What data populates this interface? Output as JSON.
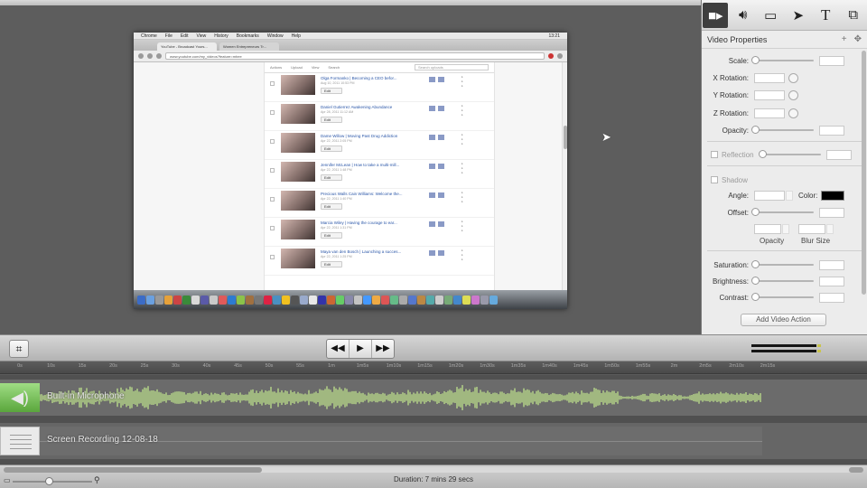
{
  "recording": {
    "menubar": [
      "Chrome",
      "File",
      "Edit",
      "View",
      "History",
      "Bookmarks",
      "Window",
      "Help"
    ],
    "clock": "13:21",
    "tabs": [
      "YouTube - Broadcast Yours...",
      "Women Entrepreneurs Tr..."
    ],
    "url": "www.youtube.com/my_videos?feature=mhee",
    "toolbar": [
      "Actions",
      "Upload",
      "View",
      "Search"
    ],
    "search_placeholder": "Search uploads",
    "videos": [
      {
        "title": "Olga Formanko | Becoming a CEO befor...",
        "date": "Aug 10, 2011 10:53 PM",
        "edit": "Edit"
      },
      {
        "title": "Daniel Gutierrez Awakening Abundance",
        "date": "Apr 28, 2011 11:12 AM",
        "edit": "Edit"
      },
      {
        "title": "Dame Willow | Moving Past Drug Addiction",
        "date": "Apr 22, 2011 2:05 PM",
        "edit": "Edit"
      },
      {
        "title": "Jennifer McLean | How to take a multi-mill...",
        "date": "Apr 22, 2011 1:48 PM",
        "edit": "Edit"
      },
      {
        "title": "Precious Walls Cain Williams: Welcome the...",
        "date": "Apr 22, 2011 1:40 PM",
        "edit": "Edit"
      },
      {
        "title": "Marcia Wiley | Having the courage to ear...",
        "date": "Apr 22, 2011 1:31 PM",
        "edit": "Edit"
      },
      {
        "title": "Maya van den Bosch | Launching a succes...",
        "date": "Apr 22, 2011 1:25 PM",
        "edit": "Edit"
      }
    ]
  },
  "inspector": {
    "tab_icons": [
      "video-camera-icon",
      "speaker-icon",
      "screen-icon",
      "pointer-icon",
      "text-icon",
      "annotation-icon"
    ],
    "title": "Video Properties",
    "plus": "+",
    "move": "✥",
    "scale": "Scale:",
    "x_rotation": "X Rotation:",
    "y_rotation": "Y Rotation:",
    "z_rotation": "Z Rotation:",
    "opacity": "Opacity:",
    "reflection": "Reflection",
    "shadow": "Shadow",
    "angle": "Angle:",
    "color": "Color:",
    "offset": "Offset:",
    "shadow_opacity": "Opacity",
    "blur_size": "Blur Size",
    "saturation": "Saturation:",
    "brightness": "Brightness:",
    "contrast": "Contrast:",
    "add_video_action": "Add Video Action",
    "shadow_color": "#000000"
  },
  "transport": {
    "rewind": "◀◀",
    "play": "▶",
    "forward": "▶▶"
  },
  "ruler": [
    "0s",
    "10s",
    "15s",
    "20s",
    "25s",
    "30s",
    "40s",
    "45s",
    "50s",
    "55s",
    "1m",
    "1m5s",
    "1m10s",
    "1m15s",
    "1m20s",
    "1m30s",
    "1m35s",
    "1m40s",
    "1m45s",
    "1m50s",
    "1m55s",
    "2m",
    "2m5s",
    "2m10s",
    "2m15s"
  ],
  "tracks": {
    "audio_label": "Built-in Microphone",
    "video_label": "Screen Recording 12-08-18"
  },
  "footer": {
    "duration": "Duration: 7 mins 29 secs"
  }
}
